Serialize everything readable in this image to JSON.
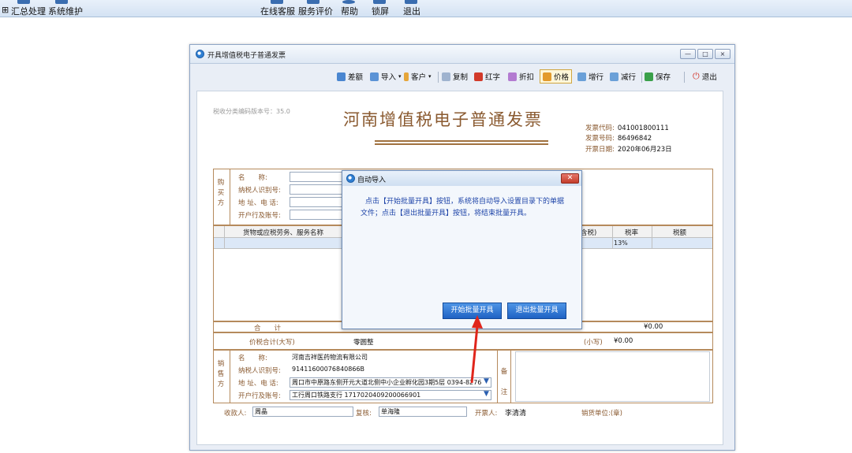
{
  "top_menu": {
    "items": [
      "汇总处理",
      "系统维护",
      "在线客服",
      "服务评价",
      "帮助",
      "锁屏",
      "退出"
    ]
  },
  "window": {
    "title": "开具增值税电子普通发票",
    "controls": {
      "min": "—",
      "max": "□",
      "close": "×"
    }
  },
  "toolbar": {
    "items": [
      "差额",
      "导入",
      "客户",
      "复制",
      "红字",
      "折扣",
      "价格",
      "增行",
      "减行",
      "保存",
      "退出"
    ]
  },
  "invoice": {
    "version": "税收分类编码版本号：35.0",
    "title": "河南增值税电子普通发票",
    "code_label": "发票代码:",
    "code": "041001800111",
    "number_label": "发票号码:",
    "number": "86496842",
    "date_label": "开票日期:",
    "date": "2020年06月23日",
    "buyer_side": "购买方",
    "buyer_labels": [
      "名　　称:",
      "纳税人识别号:",
      "地 址、电 话:",
      "开户行及账号:"
    ],
    "grid_headers": [
      "货物或应税劳务、服务名称",
      "含税)",
      "税率",
      "税额"
    ],
    "tax_rate": "13%",
    "total_label": "合　　计",
    "total_amount": "¥0.00",
    "tax_total_label": "价税合计(大写)",
    "tax_total_upper": "零圆整",
    "small_label": "(小写)",
    "small_amount": "¥0.00",
    "seller_side": "销售方",
    "seller_labels": [
      "名　　称:",
      "纳税人识别号:",
      "地 址、电 话:",
      "开户行及账号:"
    ],
    "seller_name": "河南吉祥医药物流有限公司",
    "seller_tax_id": "91411600076840866B",
    "seller_address": "周口市中原路东侧开元大道北侧中小企业孵化园3期5层  0394-8276",
    "seller_bank": "工行周口铁路支行  1717020409200066901",
    "remark_label": "备注",
    "payee_label": "收款人:",
    "payee": "周晶",
    "reviewer_label": "复核:",
    "reviewer": "单海隆",
    "drawer_label": "开票人:",
    "drawer": "李清清",
    "seller_unit_label": "销货单位:(章)"
  },
  "dialog": {
    "title": "自动导入",
    "message": "点击【开始批量开具】按钮，系统将自动导入设置目录下的单据文件；点击【退出批量开具】按钮，将结束批量开具。",
    "start_button": "开始批量开具",
    "exit_button": "退出批量开具"
  },
  "colors": {
    "invoice_brown": "#8a5a30",
    "dialog_text": "#1e44a8",
    "button_blue": "#2a6fd0",
    "arrow_red": "#e0251b"
  }
}
